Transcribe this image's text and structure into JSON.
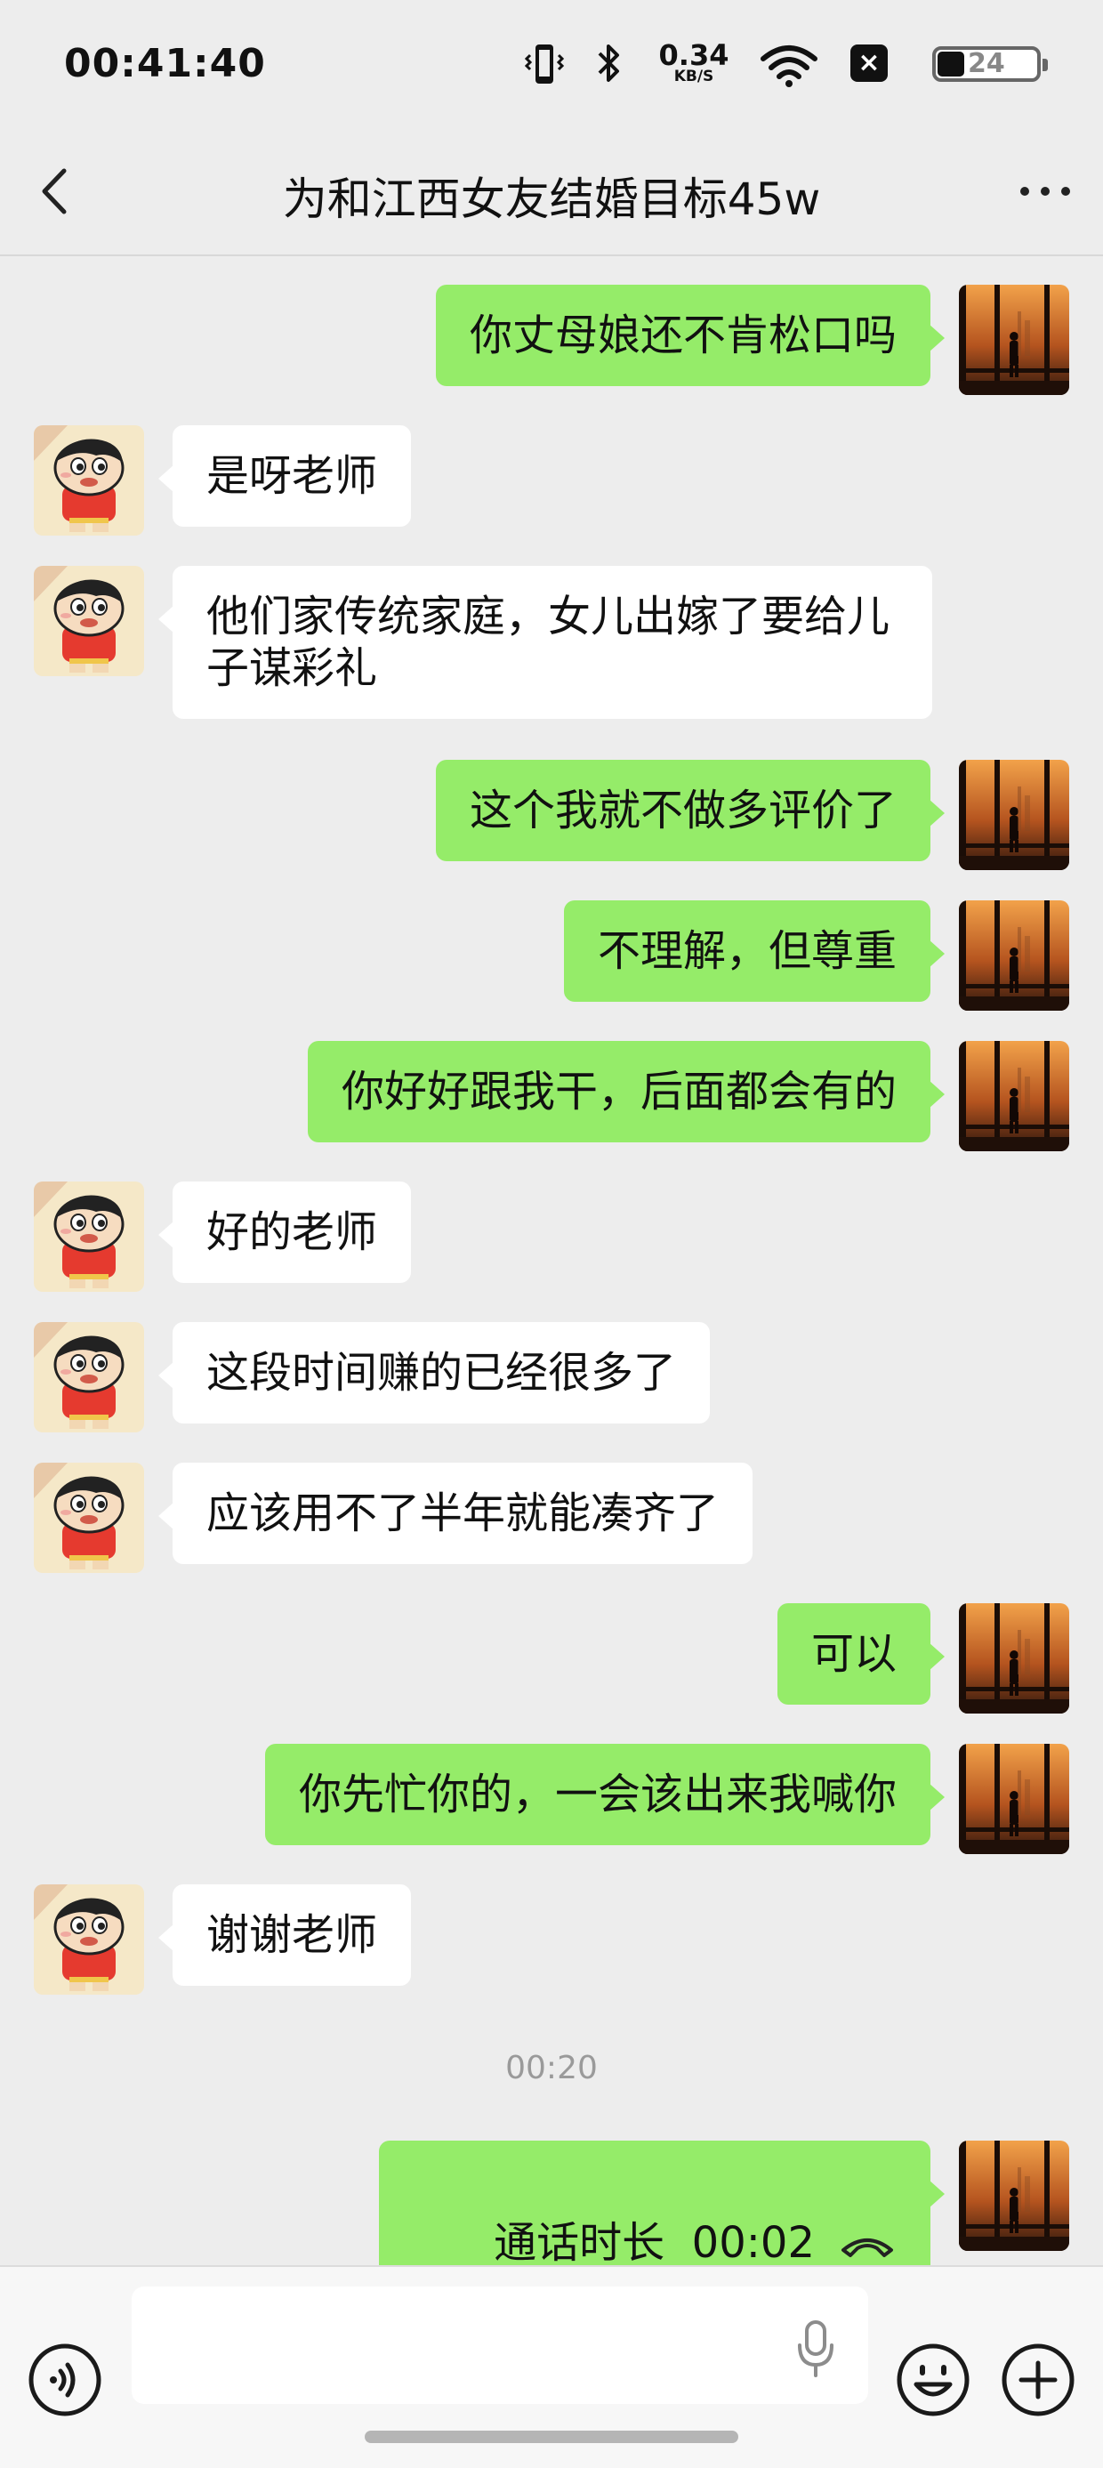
{
  "status_bar": {
    "time": "00:41:40",
    "net_speed_value": "0.34",
    "net_speed_unit": "KB/S",
    "battery_level": "24"
  },
  "header": {
    "title": "为和江西女友结婚目标45w"
  },
  "messages": [
    {
      "from": "me",
      "text": "你丈母娘还不肯松口吗"
    },
    {
      "from": "friend",
      "text": "是呀老师"
    },
    {
      "from": "friend",
      "text": "他们家传统家庭，女儿出嫁了要给儿子谋彩礼"
    },
    {
      "from": "me",
      "text": "这个我就不做多评价了"
    },
    {
      "from": "me",
      "text": "不理解，但尊重"
    },
    {
      "from": "me",
      "text": "你好好跟我干，后面都会有的"
    },
    {
      "from": "friend",
      "text": "好的老师"
    },
    {
      "from": "friend",
      "text": "这段时间赚的已经很多了"
    },
    {
      "from": "friend",
      "text": "应该用不了半年就能凑齐了"
    },
    {
      "from": "me",
      "text": "可以"
    },
    {
      "from": "me",
      "text": "你先忙你的，一会该出来我喊你"
    },
    {
      "from": "friend",
      "text": "谢谢老师"
    }
  ],
  "timestamp": "00:20",
  "call_record": {
    "label": "通话时长",
    "duration": "00:02"
  },
  "input_bar": {
    "placeholder": ""
  },
  "colors": {
    "background": "#ededed",
    "my_bubble": "#95ec69",
    "friend_bubble": "#ffffff"
  }
}
